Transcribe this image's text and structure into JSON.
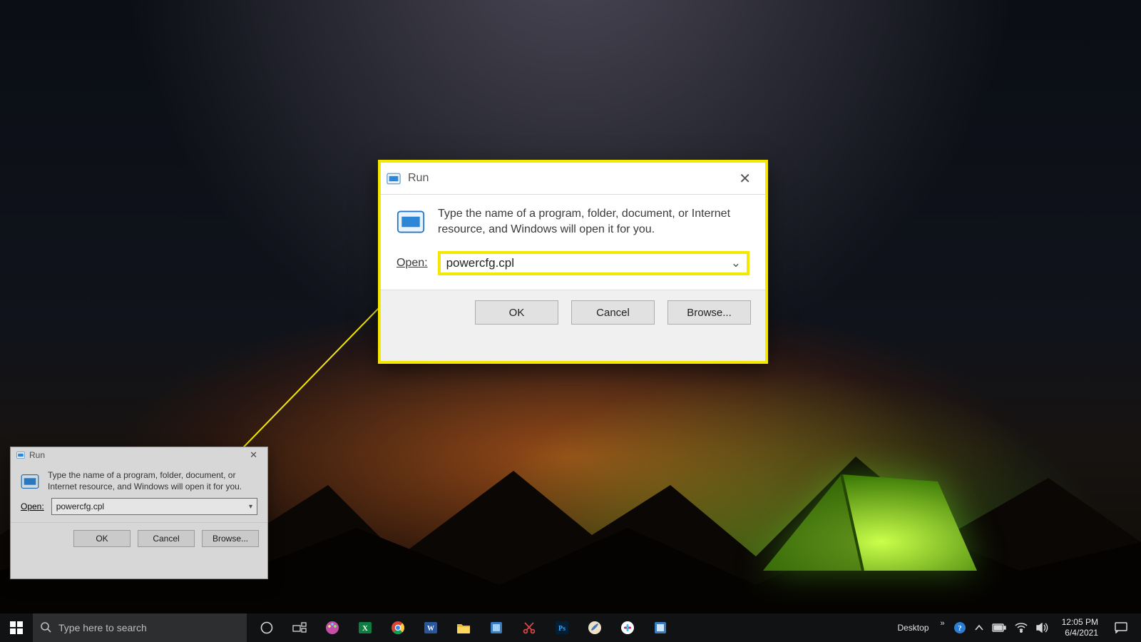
{
  "run_dialog": {
    "title": "Run",
    "description": "Type the name of a program, folder, document, or Internet resource, and Windows will open it for you.",
    "open_label": "Open:",
    "open_value": "powercfg.cpl",
    "buttons": {
      "ok": "OK",
      "cancel": "Cancel",
      "browse": "Browse..."
    }
  },
  "taskbar": {
    "search_placeholder": "Type here to search",
    "desktop_label": "Desktop",
    "clock": {
      "time": "12:05 PM",
      "date": "6/4/2021"
    }
  },
  "annotation": {
    "highlight_color": "#f4e800"
  }
}
